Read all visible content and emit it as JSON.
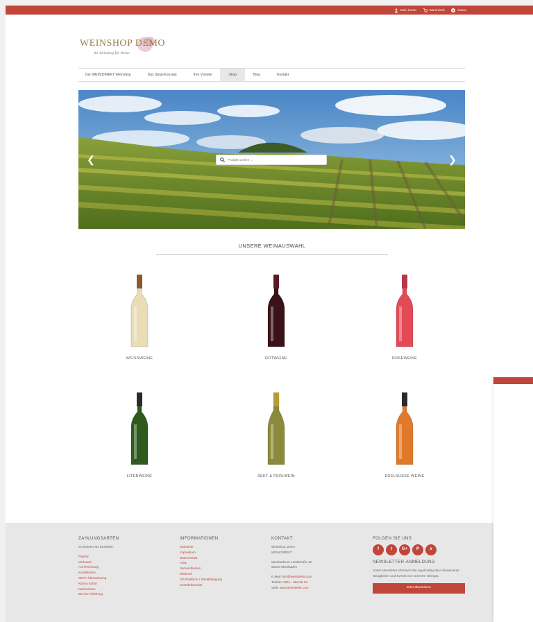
{
  "topbar": {
    "links": [
      {
        "label": "Mein Konto",
        "icon": "user-icon"
      },
      {
        "label": "Warenkorb",
        "icon": "cart-icon"
      },
      {
        "label": "Kasse",
        "icon": "checkout-icon"
      }
    ]
  },
  "logo": {
    "text": "WEINSHOP DEMO",
    "tagline": "Ihr Weinshop für Weine"
  },
  "nav": {
    "items": [
      "Der WEIN:DIREKT Weinshop",
      "Das Shop-Konzept",
      "Ihre Vorteile",
      "Shop",
      "Blog",
      "Kontakt"
    ],
    "active": "Shop"
  },
  "search": {
    "placeholder": "Produkt suchen ..."
  },
  "section_title": "UNSERE WEINAUSWAHL",
  "categories": [
    {
      "label": "WEISSWEINE",
      "color": "#e9ddb5"
    },
    {
      "label": "ROTWEINE",
      "color": "#3a1218"
    },
    {
      "label": "ROSÉWEINE",
      "color": "#e44a55"
    },
    {
      "label": "LITERWEINE",
      "color": "#2f5a1e"
    },
    {
      "label": "SEKT & PERLWEIN",
      "color": "#8a8a3a"
    },
    {
      "label": "EDELSÜSSE WEINE",
      "color": "#e07a2a"
    }
  ],
  "footer": {
    "payment": {
      "title": "ZAHLUNGSARTEN",
      "intro": "So können Sie bezahlen:",
      "items": [
        "PayPal",
        "Vorkasse",
        "Auf Rechnung",
        "Kreditkarten",
        "SEPA-Überweisung",
        "Klarna Sofort",
        "Nachnahme",
        "Bar bei Abholung"
      ]
    },
    "info": {
      "title": "INFORMATIONEN",
      "items": [
        "Startseite",
        "Impressum",
        "Datenschutz",
        "AGB",
        "Versandkosten",
        "Widerruf",
        "OS-Plattform / Streitbeilegung",
        "Kontaktformular"
      ]
    },
    "contact": {
      "title": "KONTAKT",
      "name": "Weinshop Demo",
      "company": "WEIN:DIREKT",
      "street": "Wiesbadener Landstraße 16",
      "city": "65203 Wiesbaden",
      "email_label": "E-Mail:",
      "email": "info@weindirekt.com",
      "phone_label": "Telefon:",
      "phone": "0611 - 950 55 22",
      "web_label": "Web:",
      "web": "www.weindirekt.com"
    },
    "follow": {
      "title": "FOLGEN SIE UNS",
      "icons": [
        "f",
        "t",
        "G+",
        "P",
        "x"
      ]
    },
    "newsletter": {
      "title": "NEWSLETTER-ANMELDUNG",
      "text": "Unser Newsletter informiert Sie regelmäßig über interessante Neuigkeiten und Events von unserem Weingut.",
      "button": "Jetzt abonnieren"
    }
  },
  "colors": {
    "accent": "#c0463a",
    "footer_bg": "#e7e7e7"
  }
}
